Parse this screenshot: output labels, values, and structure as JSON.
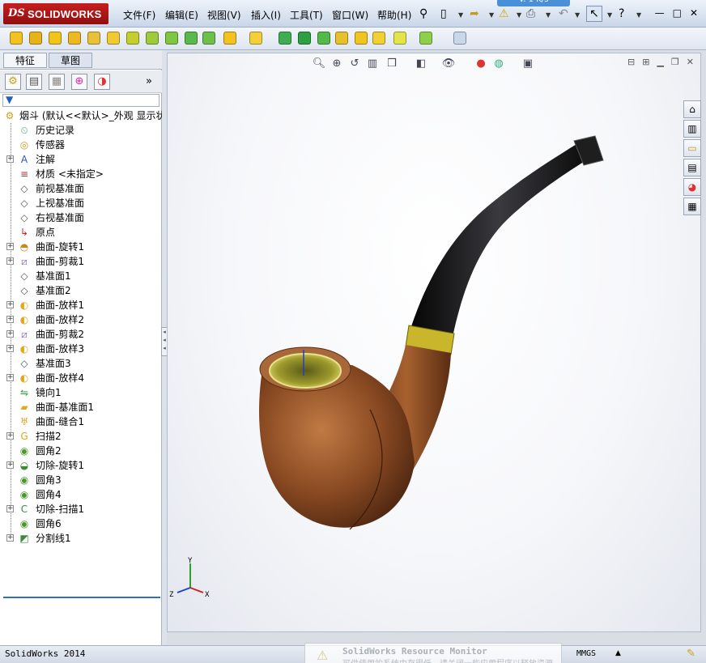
{
  "app": {
    "brand_prefix": "DS",
    "brand_name": "SOLIDWORKS",
    "status_version": "SolidWorks 2014",
    "units": "MMGS"
  },
  "menus": [
    "文件(F)",
    "编辑(E)",
    "视图(V)",
    "插入(I)",
    "工具(T)",
    "窗口(W)",
    "帮助(H)"
  ],
  "top_widget": "V. 1 K/s",
  "tabs": [
    "特征",
    "草图"
  ],
  "feature_tree": {
    "root": "烟斗  (默认<<默认>_外观 显示状态",
    "items": [
      {
        "label": "历史记录",
        "icon": "history-icon",
        "expandable": false
      },
      {
        "label": "传感器",
        "icon": "sensor-icon",
        "expandable": false
      },
      {
        "label": "注解",
        "icon": "annotation-icon",
        "expandable": true
      },
      {
        "label": "材质 <未指定>",
        "icon": "material-icon",
        "expandable": false
      },
      {
        "label": "前视基准面",
        "icon": "plane-icon",
        "expandable": false
      },
      {
        "label": "上视基准面",
        "icon": "plane-icon",
        "expandable": false
      },
      {
        "label": "右视基准面",
        "icon": "plane-icon",
        "expandable": false
      },
      {
        "label": "原点",
        "icon": "origin-icon",
        "expandable": false
      },
      {
        "label": "曲面-旋转1",
        "icon": "surface-revolve-icon",
        "expandable": true
      },
      {
        "label": "曲面-剪裁1",
        "icon": "surface-trim-icon",
        "expandable": true
      },
      {
        "label": "基准面1",
        "icon": "plane-icon",
        "expandable": false
      },
      {
        "label": "基准面2",
        "icon": "plane-icon",
        "expandable": false
      },
      {
        "label": "曲面-放样1",
        "icon": "surface-loft-icon",
        "expandable": true
      },
      {
        "label": "曲面-放样2",
        "icon": "surface-loft-icon",
        "expandable": true
      },
      {
        "label": "曲面-剪裁2",
        "icon": "surface-trim-icon",
        "expandable": true
      },
      {
        "label": "曲面-放样3",
        "icon": "surface-loft-icon",
        "expandable": true
      },
      {
        "label": "基准面3",
        "icon": "plane-icon",
        "expandable": false
      },
      {
        "label": "曲面-放样4",
        "icon": "surface-loft-icon",
        "expandable": true
      },
      {
        "label": "镜向1",
        "icon": "mirror-icon",
        "expandable": false
      },
      {
        "label": "曲面-基准面1",
        "icon": "planar-surface-icon",
        "expandable": false
      },
      {
        "label": "曲面-缝合1",
        "icon": "knit-icon",
        "expandable": false
      },
      {
        "label": "扫描2",
        "icon": "sweep-icon",
        "expandable": true
      },
      {
        "label": "圆角2",
        "icon": "fillet-icon",
        "expandable": false
      },
      {
        "label": "切除-旋转1",
        "icon": "cut-revolve-icon",
        "expandable": true
      },
      {
        "label": "圆角3",
        "icon": "fillet-icon",
        "expandable": false
      },
      {
        "label": "圆角4",
        "icon": "fillet-icon",
        "expandable": false
      },
      {
        "label": "切除-扫描1",
        "icon": "cut-sweep-icon",
        "expandable": true
      },
      {
        "label": "圆角6",
        "icon": "fillet-icon",
        "expandable": false
      },
      {
        "label": "分割线1",
        "icon": "split-line-icon",
        "expandable": true
      }
    ]
  },
  "notification": {
    "title": "SolidWorks Resource Monitor",
    "message": "可供使用的系统内存很低。请关闭一些应用程序以释放资源"
  },
  "triad": {
    "x": "X",
    "y": "Y",
    "z": "Z"
  },
  "colors": {
    "brand_red": "#b51818",
    "briar": "#8a4a22",
    "stem": "#1a1a1a",
    "band": "#c9b62a"
  }
}
